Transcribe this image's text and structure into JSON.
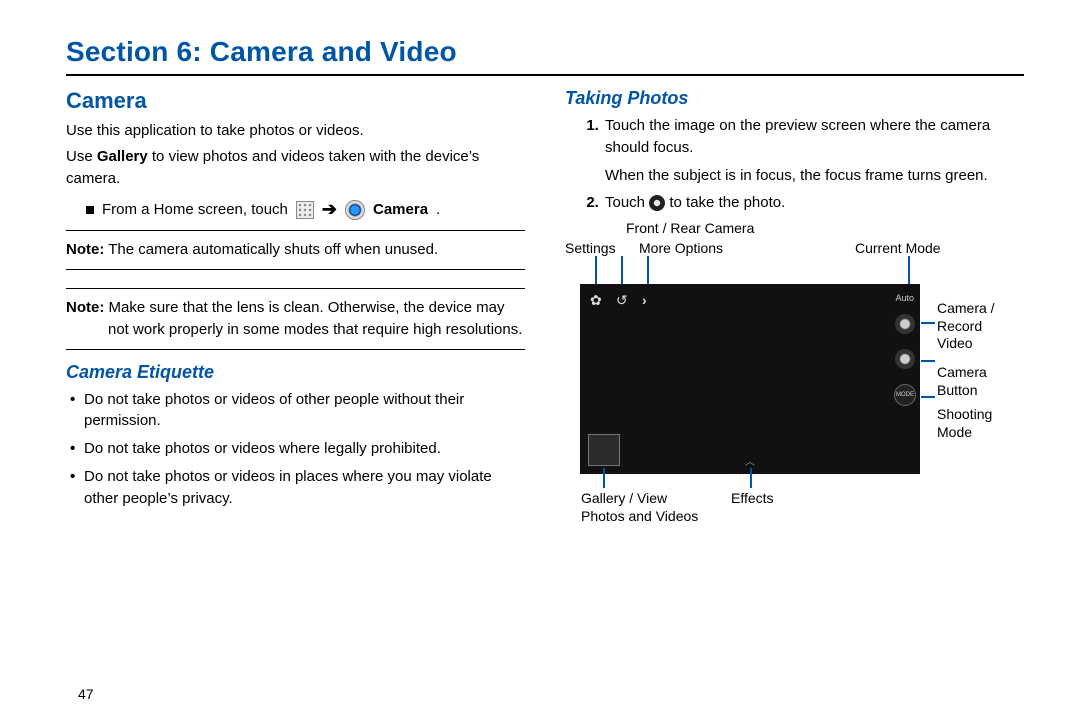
{
  "section_title": "Section 6: Camera and Video",
  "page_number": "47",
  "left": {
    "heading": "Camera",
    "p1": "Use this application to take photos or videos.",
    "p2_pre": "Use ",
    "p2_bold": "Gallery",
    "p2_post": " to view photos and videos taken with the device’s camera.",
    "nav_pre": "From a Home screen, touch ",
    "nav_post_bold": "Camera",
    "note1_label": "Note:",
    "note1_text": " The camera automatically shuts off when unused.",
    "note2_label": "Note:",
    "note2_text": " Make sure that the lens is clean. Otherwise, the device may not work properly in some modes that require high resolutions.",
    "sub_heading": "Camera Etiquette",
    "bullets": [
      "Do not take photos or videos of other people without their permission.",
      "Do not take photos or videos where legally prohibited.",
      "Do not take photos or videos in places where you may violate other people’s privacy."
    ]
  },
  "right": {
    "sub_heading": "Taking Photos",
    "step1a": "Touch the image on the preview screen where the camera should focus.",
    "step1b": "When the subject is in focus, the focus frame turns green.",
    "step2_pre": "Touch ",
    "step2_post": " to take the photo.",
    "labels": {
      "front_rear": "Front / Rear Camera",
      "settings": "Settings",
      "more_options": "More Options",
      "current_mode": "Current Mode",
      "camera_record": "Camera / Record Video",
      "camera_button": "Camera Button",
      "shooting_mode": "Shooting Mode",
      "gallery_view": "Gallery / View Photos and Videos",
      "effects": "Effects"
    },
    "cam_auto": "Auto",
    "cam_mode_text": "MODE"
  }
}
